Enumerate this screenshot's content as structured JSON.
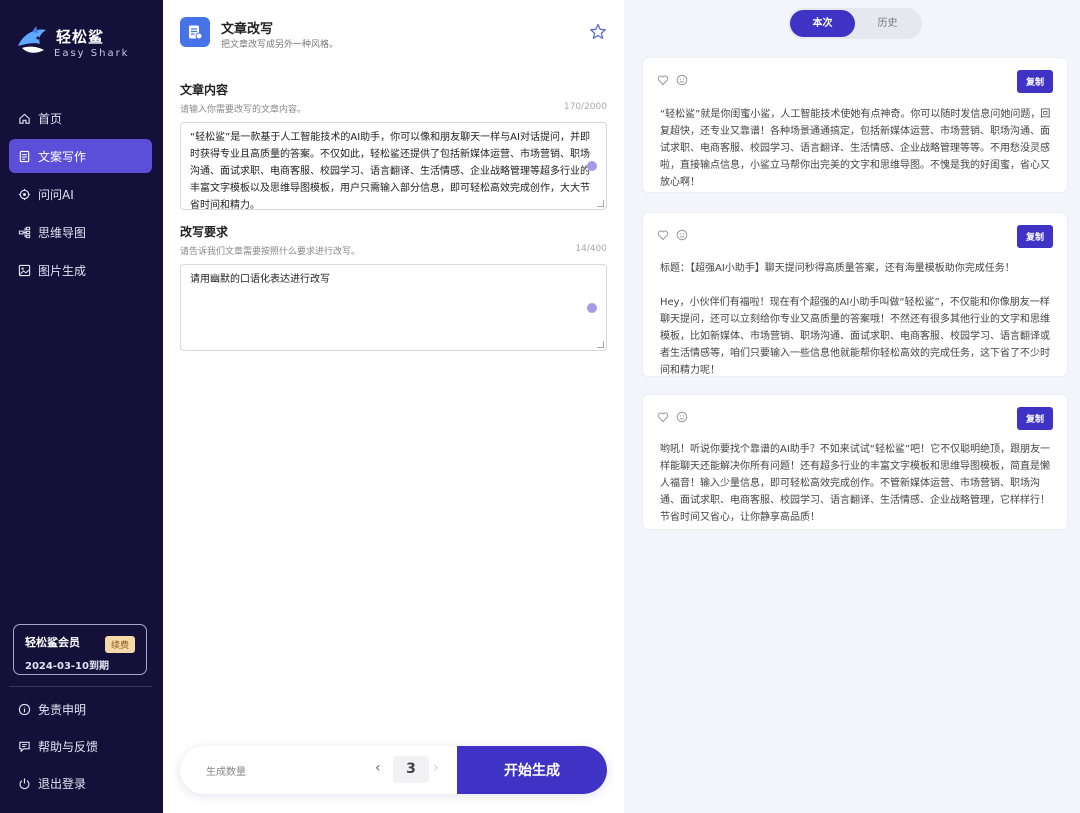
{
  "brand": {
    "name": "轻松鲨",
    "sub": "Easy Shark"
  },
  "nav": [
    {
      "label": "首页",
      "icon": "home-icon",
      "active": false
    },
    {
      "label": "文案写作",
      "icon": "document-icon",
      "active": true
    },
    {
      "label": "问问AI",
      "icon": "ai-chat-icon",
      "active": false
    },
    {
      "label": "思维导图",
      "icon": "mindmap-icon",
      "active": false
    },
    {
      "label": "图片生成",
      "icon": "image-icon",
      "active": false
    }
  ],
  "member": {
    "name": "轻松鲨会员",
    "expiry": "2024-03-10到期",
    "renew": "续费"
  },
  "bottom_nav": [
    {
      "label": "免责申明",
      "icon": "info-icon"
    },
    {
      "label": "帮助与反馈",
      "icon": "feedback-icon"
    },
    {
      "label": "退出登录",
      "icon": "power-icon"
    }
  ],
  "tool": {
    "title": "文章改写",
    "desc": "把文章改写成另外一种风格。"
  },
  "content": {
    "label": "文章内容",
    "hint": "请输入你需要改写的文章内容。",
    "counter": "170/2000",
    "value": "“轻松鲨”是一款基于人工智能技术的AI助手，你可以像和朋友聊天一样与AI对话提问，并即时获得专业且高质量的答案。不仅如此，轻松鲨还提供了包括新媒体运营、市场营销、职场沟通、面试求职、电商客服、校园学习、语言翻译、生活情感、企业战略管理等超多行业的丰富文字模板以及思维导图模板，用户只需输入部分信息，即可轻松高效完成创作，大大节省时间和精力。"
  },
  "requirement": {
    "label": "改写要求",
    "hint": "请告诉我们文章需要按照什么要求进行改写。",
    "counter": "14/400",
    "value": "请用幽默的口语化表达进行改写"
  },
  "generate": {
    "label": "生成数量",
    "count": "3",
    "prev": "‹",
    "next": "›",
    "button": "开始生成"
  },
  "tabs": {
    "current": "本次",
    "history": "历史"
  },
  "results": {
    "copy_label": "复制",
    "items": [
      {
        "text": "“轻松鲨”就是你闺蜜小鲨，人工智能技术使她有点神奇。你可以随时发信息问她问题，回复超快，还专业又靠谱！各种场景通通搞定，包括新媒体运营、市场营销、职场沟通、面试求职、电商客服、校园学习、语言翻译、生活情感、企业战略管理等等。不用愁没灵感啦，直接输点信息，小鲨立马帮你出完美的文字和思维导图。不愧是我的好闺蜜，省心又放心啊！"
      },
      {
        "text": "标题：【超强AI小助手】聊天提问秒得高质量答案，还有海量模板助你完成任务！\n\nHey，小伙伴们有福啦！现在有个超强的AI小助手叫做“轻松鲨”，不仅能和你像朋友一样聊天提问，还可以立刻给你专业又高质量的答案哦！不然还有很多其他行业的文字和思维模板，比如新媒体、市场营销、职场沟通、面试求职、电商客服、校园学习、语言翻译或者生活情感等，咱们只要输入一些信息他就能帮你轻松高效的完成任务，这下省了不少时间和精力呢！"
      },
      {
        "text": "哟吼！听说你要找个靠谱的AI助手？不如来试试“轻松鲨”吧！它不仅聪明绝顶，跟朋友一样能聊天还能解决你所有问题！还有超多行业的丰富文字模板和思维导图模板，简直是懒人福音！输入少量信息，即可轻松高效完成创作。不管新媒体运营、市场营销、职场沟通、面试求职、电商客服、校园学习、语言翻译、生活情感、企业战略管理，它样样行！节省时间又省心，让你静享高品质！"
      }
    ]
  },
  "colors": {
    "sidebar": "#15103a",
    "accent": "#3f33c6",
    "nav_active": "#5b4fd9"
  }
}
